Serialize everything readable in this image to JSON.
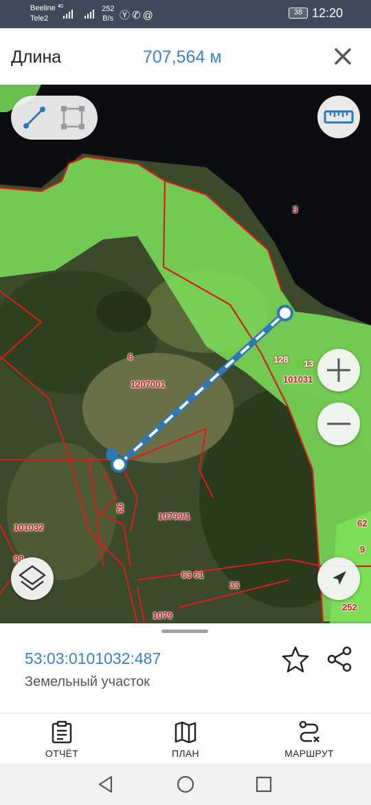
{
  "status_bar": {
    "carrier1": "Beeline",
    "carrier2": "Tele2",
    "net1": "4G",
    "speed_value": "252",
    "speed_unit": "B/s",
    "app_icons": "Ⓨ✆@",
    "battery": "38",
    "time": "12:20"
  },
  "header": {
    "title": "Длина",
    "value": "707,564 м",
    "close_icon": "close-icon"
  },
  "map": {
    "colors": {
      "parcel_border": "#d61e1e",
      "forest_zone": "#7ee05a",
      "measure_line": "#2b77b8",
      "water": "#0b0d10"
    },
    "labels": [
      {
        "id": "l1",
        "text": "3"
      },
      {
        "id": "l2",
        "text": "6"
      },
      {
        "id": "l3",
        "text": "1207001"
      },
      {
        "id": "l4",
        "text": "128"
      },
      {
        "id": "l5",
        "text": "13"
      },
      {
        "id": "l6",
        "text": "101031"
      },
      {
        "id": "l7",
        "text": "101032"
      },
      {
        "id": "l8",
        "text": "93"
      },
      {
        "id": "l9",
        "text": "10799/1"
      },
      {
        "id": "l10",
        "text": "98"
      },
      {
        "id": "l11",
        "text": "63 61"
      },
      {
        "id": "l12",
        "text": "33"
      },
      {
        "id": "l13",
        "text": "62"
      },
      {
        "id": "l14",
        "text": "9"
      },
      {
        "id": "l15",
        "text": "252"
      },
      {
        "id": "l16",
        "text": "1079"
      }
    ]
  },
  "sheet": {
    "cadastral_number": "53:03:0101032:487",
    "subtitle": "Земельный участок"
  },
  "tabs": [
    {
      "label": "ОТЧЁТ",
      "icon": "report-icon"
    },
    {
      "label": "ПЛАН",
      "icon": "map-plan-icon"
    },
    {
      "label": "МАРШРУТ",
      "icon": "route-icon"
    }
  ]
}
